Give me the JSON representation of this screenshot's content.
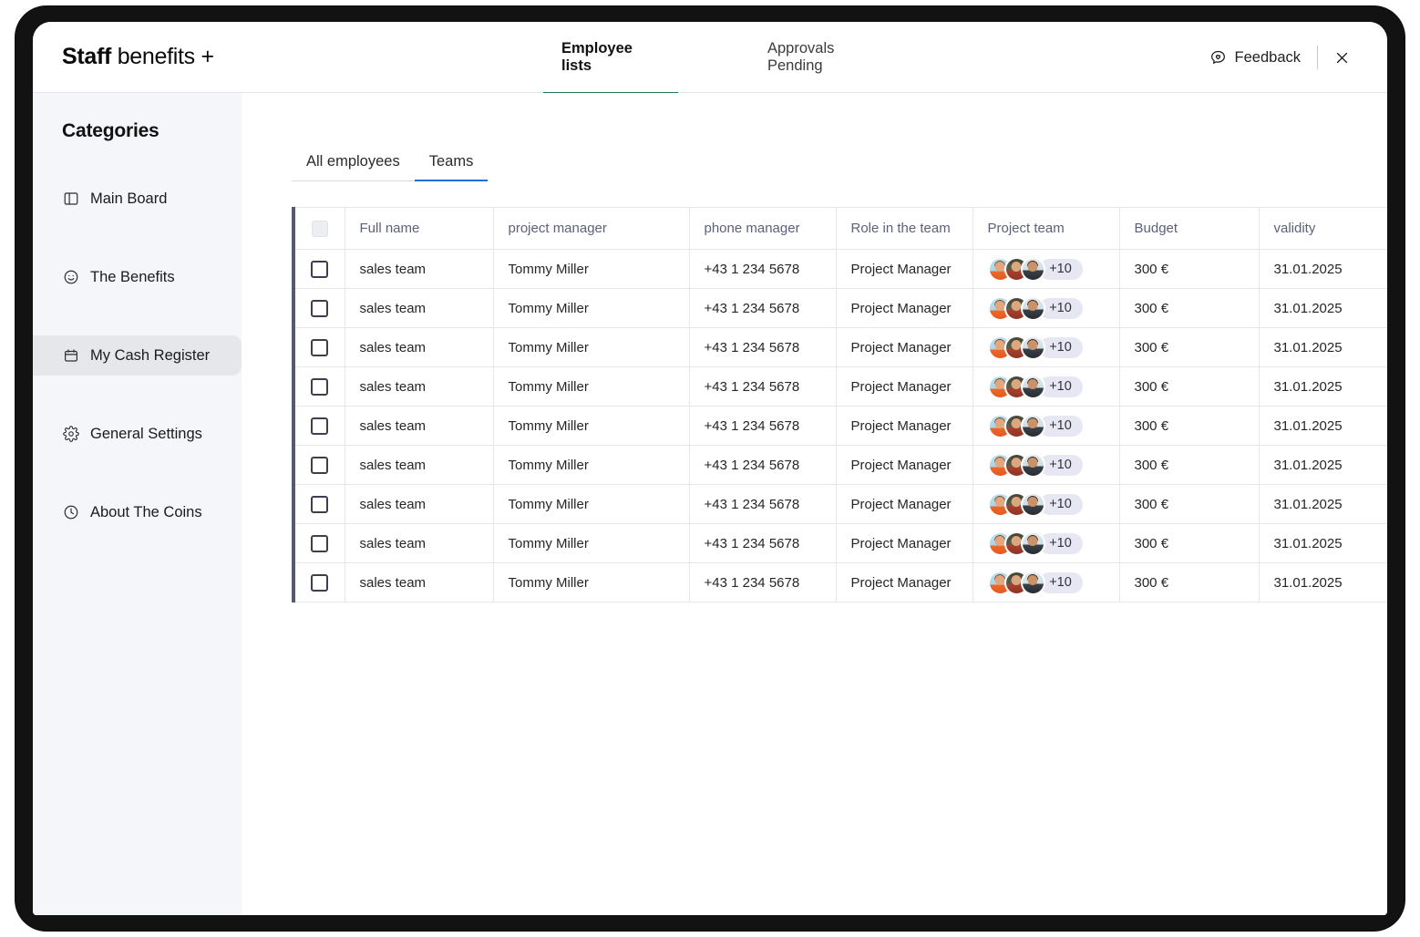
{
  "brand": {
    "strong": "Staff",
    "light": " benefits",
    "plus": " +"
  },
  "topnav": {
    "items": [
      {
        "label": "Employee lists",
        "active": true
      },
      {
        "label": "Approvals Pending",
        "active": false
      }
    ]
  },
  "topright": {
    "feedback_label": "Feedback",
    "feedback_icon": "speech-bubble-heart-icon",
    "close_icon": "close-icon"
  },
  "sidebar": {
    "title": "Categories",
    "items": [
      {
        "label": "Main Board",
        "icon": "layout-panel-icon",
        "active": false
      },
      {
        "label": "The Benefits",
        "icon": "smiley-face-icon",
        "active": false
      },
      {
        "label": "My Cash Register",
        "icon": "calendar-icon",
        "active": true
      },
      {
        "label": "General Settings",
        "icon": "gear-icon",
        "active": false
      },
      {
        "label": "About The Coins",
        "icon": "clock-icon",
        "active": false
      }
    ]
  },
  "subtabs": {
    "items": [
      {
        "label": "All employees",
        "active": false
      },
      {
        "label": "Teams",
        "active": true
      }
    ]
  },
  "table": {
    "columns": [
      {
        "key": "chk",
        "label": ""
      },
      {
        "key": "name",
        "label": "Full name"
      },
      {
        "key": "pm",
        "label": "project manager"
      },
      {
        "key": "phone",
        "label": "phone manager"
      },
      {
        "key": "role",
        "label": "Role in the team"
      },
      {
        "key": "team",
        "label": "Project team"
      },
      {
        "key": "bud",
        "label": "Budget"
      },
      {
        "key": "val",
        "label": "validity"
      }
    ],
    "rows": [
      {
        "name": "sales team",
        "pm": "Tommy Miller",
        "phone": "+43 1 234 5678",
        "role": "Project Manager",
        "team_overflow": "+10",
        "bud": "300 €",
        "val": "31.01.2025"
      },
      {
        "name": "sales team",
        "pm": "Tommy Miller",
        "phone": "+43 1 234 5678",
        "role": "Project Manager",
        "team_overflow": "+10",
        "bud": "300 €",
        "val": "31.01.2025"
      },
      {
        "name": "sales team",
        "pm": "Tommy Miller",
        "phone": "+43 1 234 5678",
        "role": "Project Manager",
        "team_overflow": "+10",
        "bud": "300 €",
        "val": "31.01.2025"
      },
      {
        "name": "sales team",
        "pm": "Tommy Miller",
        "phone": "+43 1 234 5678",
        "role": "Project Manager",
        "team_overflow": "+10",
        "bud": "300 €",
        "val": "31.01.2025"
      },
      {
        "name": "sales team",
        "pm": "Tommy Miller",
        "phone": "+43 1 234 5678",
        "role": "Project Manager",
        "team_overflow": "+10",
        "bud": "300 €",
        "val": "31.01.2025"
      },
      {
        "name": "sales team",
        "pm": "Tommy Miller",
        "phone": "+43 1 234 5678",
        "role": "Project Manager",
        "team_overflow": "+10",
        "bud": "300 €",
        "val": "31.01.2025"
      },
      {
        "name": "sales team",
        "pm": "Tommy Miller",
        "phone": "+43 1 234 5678",
        "role": "Project Manager",
        "team_overflow": "+10",
        "bud": "300 €",
        "val": "31.01.2025"
      },
      {
        "name": "sales team",
        "pm": "Tommy Miller",
        "phone": "+43 1 234 5678",
        "role": "Project Manager",
        "team_overflow": "+10",
        "bud": "300 €",
        "val": "31.01.2025"
      },
      {
        "name": "sales team",
        "pm": "Tommy Miller",
        "phone": "+43 1 234 5678",
        "role": "Project Manager",
        "team_overflow": "+10",
        "bud": "300 €",
        "val": "31.01.2025"
      }
    ]
  },
  "colors": {
    "active_tab_underline": "#1f7a4d",
    "subtab_underline": "#1f6fd8",
    "sidebar_bg": "#f5f6f9",
    "sidebar_active_bg": "#e5e7eb",
    "table_left_border": "#565a70",
    "avatar_pill_bg": "#e6e7f2"
  }
}
